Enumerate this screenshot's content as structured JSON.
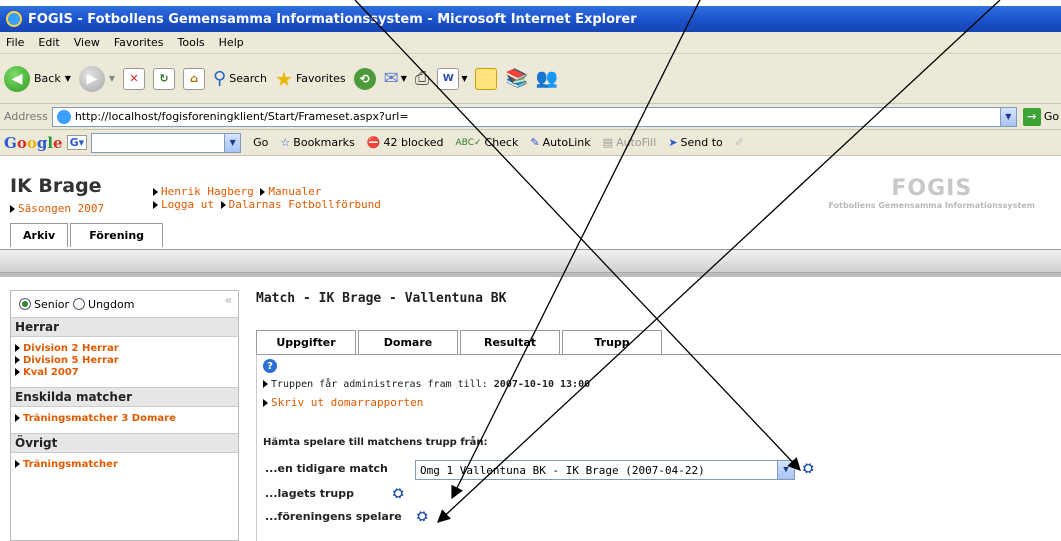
{
  "window": {
    "title": "FOGIS - Fotbollens Gemensamma Informationssystem - Microsoft Internet Explorer"
  },
  "menu": [
    "File",
    "Edit",
    "View",
    "Favorites",
    "Tools",
    "Help"
  ],
  "toolbar": {
    "back": "Back",
    "search": "Search",
    "favorites": "Favorites"
  },
  "address": {
    "label": "Address",
    "url": "http://localhost/fogisforeningklient/Start/Frameset.aspx?url=",
    "go": "Go"
  },
  "google": {
    "go": "Go",
    "bookmarks": "Bookmarks",
    "blocked": "42 blocked",
    "check": "Check",
    "autolink": "AutoLink",
    "autofill": "AutoFill",
    "sendto": "Send to"
  },
  "header": {
    "club": "IK Brage",
    "season": "Säsongen 2007",
    "user": "Henrik Hagberg",
    "manuals": "Manualer",
    "logout": "Logga ut",
    "district": "Dalarnas Fotbollförbund",
    "logo": "FOGIS",
    "logo_sub": "Fotbollens Gemensamma Informationssystem"
  },
  "main_tabs": [
    "Arkiv",
    "Förening"
  ],
  "sidebar": {
    "senior": "Senior",
    "youth": "Ungdom",
    "sections": [
      {
        "title": "Herrar",
        "items": [
          "Division 2 Herrar",
          "Division 5 Herrar",
          "Kval 2007"
        ]
      },
      {
        "title": "Enskilda matcher",
        "items": [
          "Träningsmatcher 3 Domare"
        ]
      },
      {
        "title": "Övrigt",
        "items": [
          "Träningsmatcher"
        ]
      }
    ]
  },
  "content": {
    "match_title": "Match - IK Brage - Vallentuna BK",
    "tabs": [
      "Uppgifter",
      "Domare",
      "Resultat",
      "Trupp"
    ],
    "deadline_text": "Truppen får administreras fram till:",
    "deadline_value": "2007-10-10 13:00",
    "print_link": "Skriv ut domarrapporten",
    "fetch_heading": "Hämta spelare till matchens trupp från:",
    "row_prev_match": "...en tidigare match",
    "prev_match_value": "Omg 1 Vallentuna BK - IK Brage (2007-04-22)",
    "row_team_squad": "...lagets trupp",
    "row_club_players": "...föreningens spelare"
  }
}
